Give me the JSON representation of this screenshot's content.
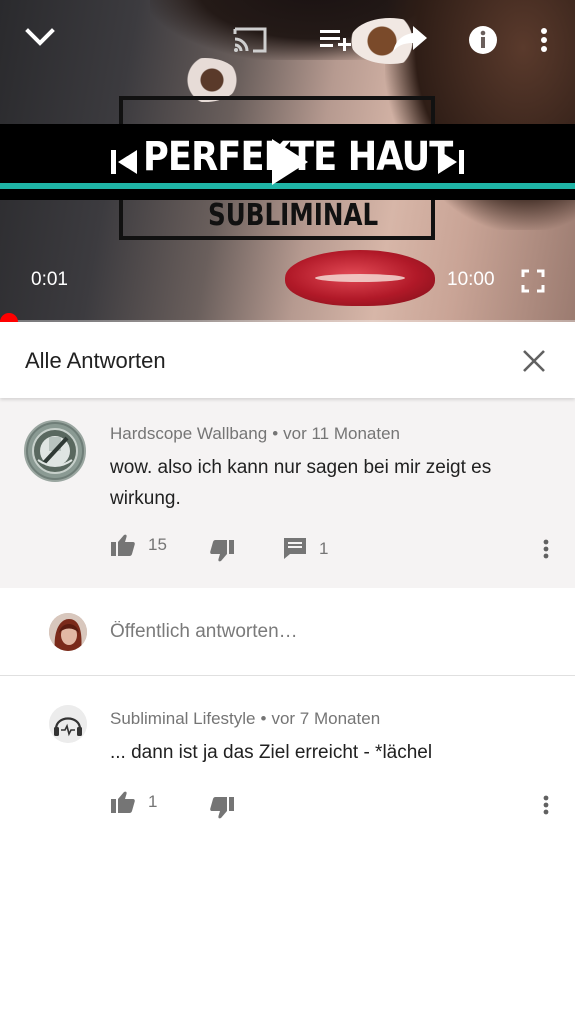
{
  "player": {
    "logo_title": "PERFEKTE HAUT",
    "logo_subtitle": "SUBLIMINAL",
    "current_time": "0:01",
    "duration": "10:00",
    "progress_fraction": 0.0017,
    "accent_color": "#1fb4a6",
    "progress_color": "#ff0000",
    "icons": [
      "chevron-down-icon",
      "cast-icon",
      "add-to-queue-icon",
      "share-icon",
      "info-icon",
      "more-vert-icon",
      "skip-previous-icon",
      "play-icon",
      "skip-next-icon",
      "fullscreen-icon"
    ]
  },
  "replies_panel": {
    "title": "Alle Antworten"
  },
  "parent_comment": {
    "author": "Hardscope Wallbang",
    "time": "vor 11 Monaten",
    "text": "wow. also ich kann nur sagen bei mir zeigt es wirkung.",
    "likes": "15",
    "replies": "1"
  },
  "reply_box": {
    "placeholder": "Öffentlich antworten…"
  },
  "reply_comment": {
    "author": "Subliminal Lifestyle",
    "time": "vor 7 Monaten",
    "text": "... dann ist ja das Ziel erreicht - *lächel",
    "likes": "1"
  },
  "separator": "•"
}
